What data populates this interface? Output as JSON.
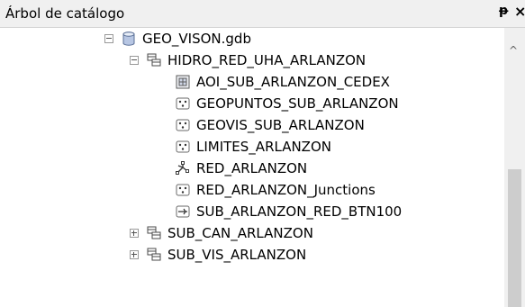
{
  "panel": {
    "title": "Árbol de catálogo",
    "pin_glyph": "ᵽ",
    "close_glyph": "×"
  },
  "tree": {
    "root": {
      "label": "GEO_VISON.gdb",
      "icon": "geodatabase-icon",
      "expander": "minus"
    },
    "datasets": [
      {
        "label": "HIDRO_RED_UHA_ARLANZON",
        "icon": "feature-dataset-icon",
        "expander": "minus",
        "children": [
          {
            "label": "AOI_SUB_ARLANZON_CEDEX",
            "icon": "raster-icon"
          },
          {
            "label": "GEOPUNTOS_SUB_ARLANZON",
            "icon": "point-feature-class-icon"
          },
          {
            "label": "GEOVIS_SUB_ARLANZON",
            "icon": "point-feature-class-icon"
          },
          {
            "label": "LIMITES_ARLANZON",
            "icon": "point-feature-class-icon"
          },
          {
            "label": "RED_ARLANZON",
            "icon": "geometric-network-icon"
          },
          {
            "label": "RED_ARLANZON_Junctions",
            "icon": "point-feature-class-icon"
          },
          {
            "label": "SUB_ARLANZON_RED_BTN100",
            "icon": "line-feature-class-icon"
          }
        ]
      },
      {
        "label": "SUB_CAN_ARLANZON",
        "icon": "feature-dataset-icon",
        "expander": "plus"
      },
      {
        "label": "SUB_VIS_ARLANZON",
        "icon": "feature-dataset-icon",
        "expander": "plus"
      }
    ]
  },
  "scrollbar": {
    "up_arrow": "^"
  }
}
